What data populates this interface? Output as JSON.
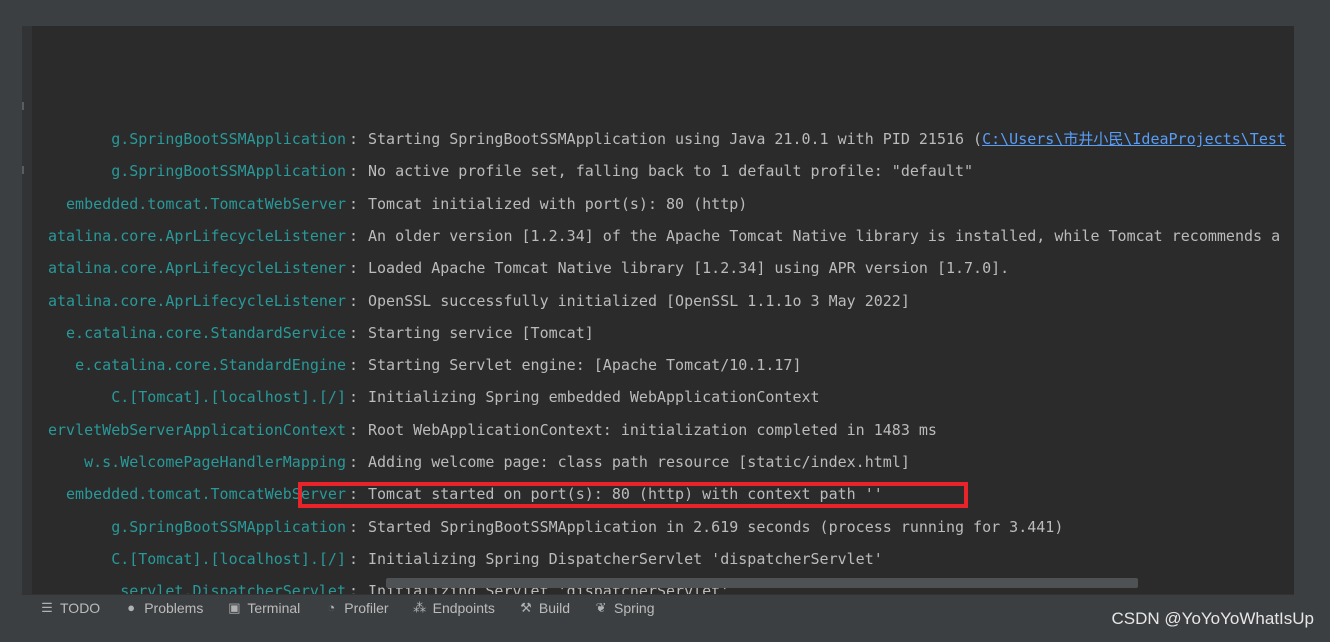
{
  "console": {
    "lines": [
      {
        "logger": "g.SpringBootSSMApplication",
        "sep": ":",
        "message": "Starting SpringBootSSMApplication using Java 21.0.1 with PID 21516 (",
        "link": "C:\\Users\\市井小民\\IdeaProjects\\Test"
      },
      {
        "logger": "g.SpringBootSSMApplication",
        "sep": ":",
        "message": "No active profile set, falling back to 1 default profile: \"default\""
      },
      {
        "logger": "embedded.tomcat.TomcatWebServer",
        "sep": ":",
        "message": "Tomcat initialized with port(s): 80 (http)"
      },
      {
        "logger": "atalina.core.AprLifecycleListener",
        "sep": ":",
        "message": "An older version [1.2.34] of the Apache Tomcat Native library is installed, while Tomcat recommends a"
      },
      {
        "logger": "atalina.core.AprLifecycleListener",
        "sep": ":",
        "message": "Loaded Apache Tomcat Native library [1.2.34] using APR version [1.7.0]."
      },
      {
        "logger": "atalina.core.AprLifecycleListener",
        "sep": ":",
        "message": "OpenSSL successfully initialized [OpenSSL 1.1.1o  3 May 2022]"
      },
      {
        "logger": "e.catalina.core.StandardService",
        "sep": ":",
        "message": "Starting service [Tomcat]"
      },
      {
        "logger": "e.catalina.core.StandardEngine",
        "sep": ":",
        "message": "Starting Servlet engine: [Apache Tomcat/10.1.17]"
      },
      {
        "logger": "C.[Tomcat].[localhost].[/]",
        "sep": ":",
        "message": "Initializing Spring embedded WebApplicationContext"
      },
      {
        "logger": "ervletWebServerApplicationContext",
        "sep": ":",
        "message": "Root WebApplicationContext: initialization completed in 1483 ms"
      },
      {
        "logger": "w.s.WelcomePageHandlerMapping",
        "sep": ":",
        "message": "Adding welcome page: class path resource [static/index.html]"
      },
      {
        "logger": "embedded.tomcat.TomcatWebServer",
        "sep": ":",
        "message": "Tomcat started on port(s): 80 (http) with context path ''"
      },
      {
        "logger": "g.SpringBootSSMApplication",
        "sep": ":",
        "message": "Started SpringBootSSMApplication in 2.619 seconds (process running for 3.441)"
      },
      {
        "logger": "C.[Tomcat].[localhost].[/]",
        "sep": ":",
        "message": "Initializing Spring DispatcherServlet 'dispatcherServlet'"
      },
      {
        "logger": "servlet.DispatcherServlet",
        "sep": ":",
        "message": "Initializing Servlet 'dispatcherServlet'"
      }
    ]
  },
  "toolbar": {
    "tabs": [
      {
        "label": "TODO",
        "icon": "list-icon",
        "glyph": "☰"
      },
      {
        "label": "Problems",
        "icon": "problems-icon",
        "glyph": "●"
      },
      {
        "label": "Terminal",
        "icon": "terminal-icon",
        "glyph": "▣"
      },
      {
        "label": "Profiler",
        "icon": "profiler-icon",
        "glyph": "◔"
      },
      {
        "label": "Endpoints",
        "icon": "endpoints-icon",
        "glyph": "⁂"
      },
      {
        "label": "Build",
        "icon": "hammer-icon",
        "glyph": "⚒"
      },
      {
        "label": "Spring",
        "icon": "spring-leaf-icon",
        "glyph": "❦"
      }
    ]
  },
  "watermark": "CSDN @YoYoYoWhatIsUp",
  "colors": {
    "background": "#2b2b2b",
    "logger": "#299999",
    "text": "#bbbbbb",
    "link": "#589df6",
    "highlight": "#e8232a"
  }
}
